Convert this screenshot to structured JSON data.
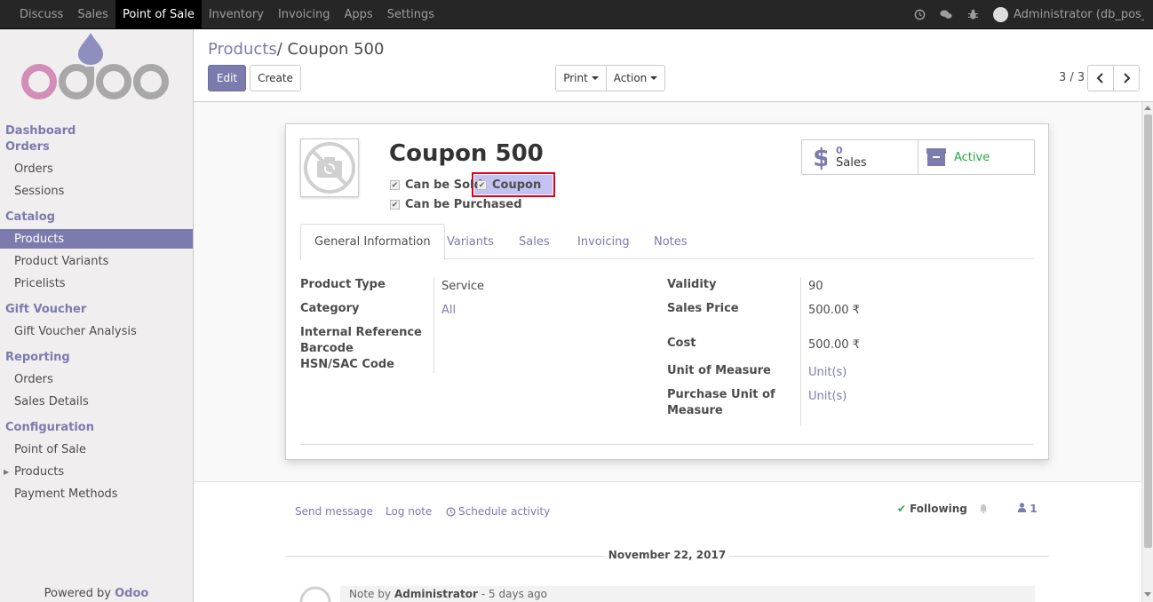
{
  "topbar": {
    "menu": [
      "Discuss",
      "Sales",
      "Point of Sale",
      "Inventory",
      "Invoicing",
      "Apps",
      "Settings"
    ],
    "active_index": 2,
    "user": "Administrator (db_pos_..."
  },
  "sidebar": {
    "sections": [
      {
        "title": "Dashboard"
      },
      {
        "title": "Orders",
        "items": [
          "Orders",
          "Sessions"
        ]
      },
      {
        "title": "Catalog",
        "items": [
          "Products",
          "Product Variants",
          "Pricelists"
        ]
      },
      {
        "title": "Gift Voucher",
        "items": [
          "Gift Voucher Analysis"
        ]
      },
      {
        "title": "Reporting",
        "items": [
          "Orders",
          "Sales Details"
        ]
      },
      {
        "title": "Configuration",
        "items": [
          "Point of Sale",
          "Products",
          "Payment Methods"
        ]
      }
    ],
    "powered_prefix": "Powered by",
    "powered_brand": "Odoo"
  },
  "control_panel": {
    "breadcrumb_parent": "Products",
    "breadcrumb_sep": "/",
    "breadcrumb_current": "Coupon 500",
    "edit_label": "Edit",
    "create_label": "Create",
    "print_label": "Print",
    "action_label": "Action",
    "pager": "3 / 3"
  },
  "form": {
    "title": "Coupon 500",
    "checkboxes": {
      "can_be_sold": "Can be Sold",
      "coupon": "Coupon",
      "can_be_purchased": "Can be Purchased"
    },
    "stat_sales_count": "0",
    "stat_sales_label": "Sales",
    "stat_active_label": "Active",
    "tabs": [
      "General Information",
      "Variants",
      "Sales",
      "Invoicing",
      "Notes"
    ],
    "fields": {
      "product_type_label": "Product Type",
      "product_type_value": "Service",
      "category_label": "Category",
      "category_value": "All",
      "internal_ref_label": "Internal Reference",
      "barcode_label": "Barcode",
      "hsn_label": "HSN/SAC Code",
      "validity_label": "Validity",
      "validity_value": "90",
      "sales_price_label": "Sales Price",
      "sales_price_value": "500.00 ₹",
      "cost_label": "Cost",
      "cost_value": "500.00 ₹",
      "uom_label": "Unit of Measure",
      "uom_value": "Unit(s)",
      "purchase_uom_label_1": "Purchase Unit of",
      "purchase_uom_label_2": "Measure",
      "purchase_uom_value": "Unit(s)"
    }
  },
  "chatter": {
    "send_message": "Send message",
    "log_note": "Log note",
    "schedule_activity": "Schedule activity",
    "following": "Following",
    "followers_count": "1",
    "date": "November 22, 2017",
    "note_prefix": "Note by",
    "note_author": "Administrator",
    "note_time": "- 5 days ago"
  },
  "colors": {
    "brand": "#7c7bad",
    "highlight_border": "#e2001a",
    "highlight_fill": "#c4c2f3",
    "active_green": "#28a745"
  }
}
